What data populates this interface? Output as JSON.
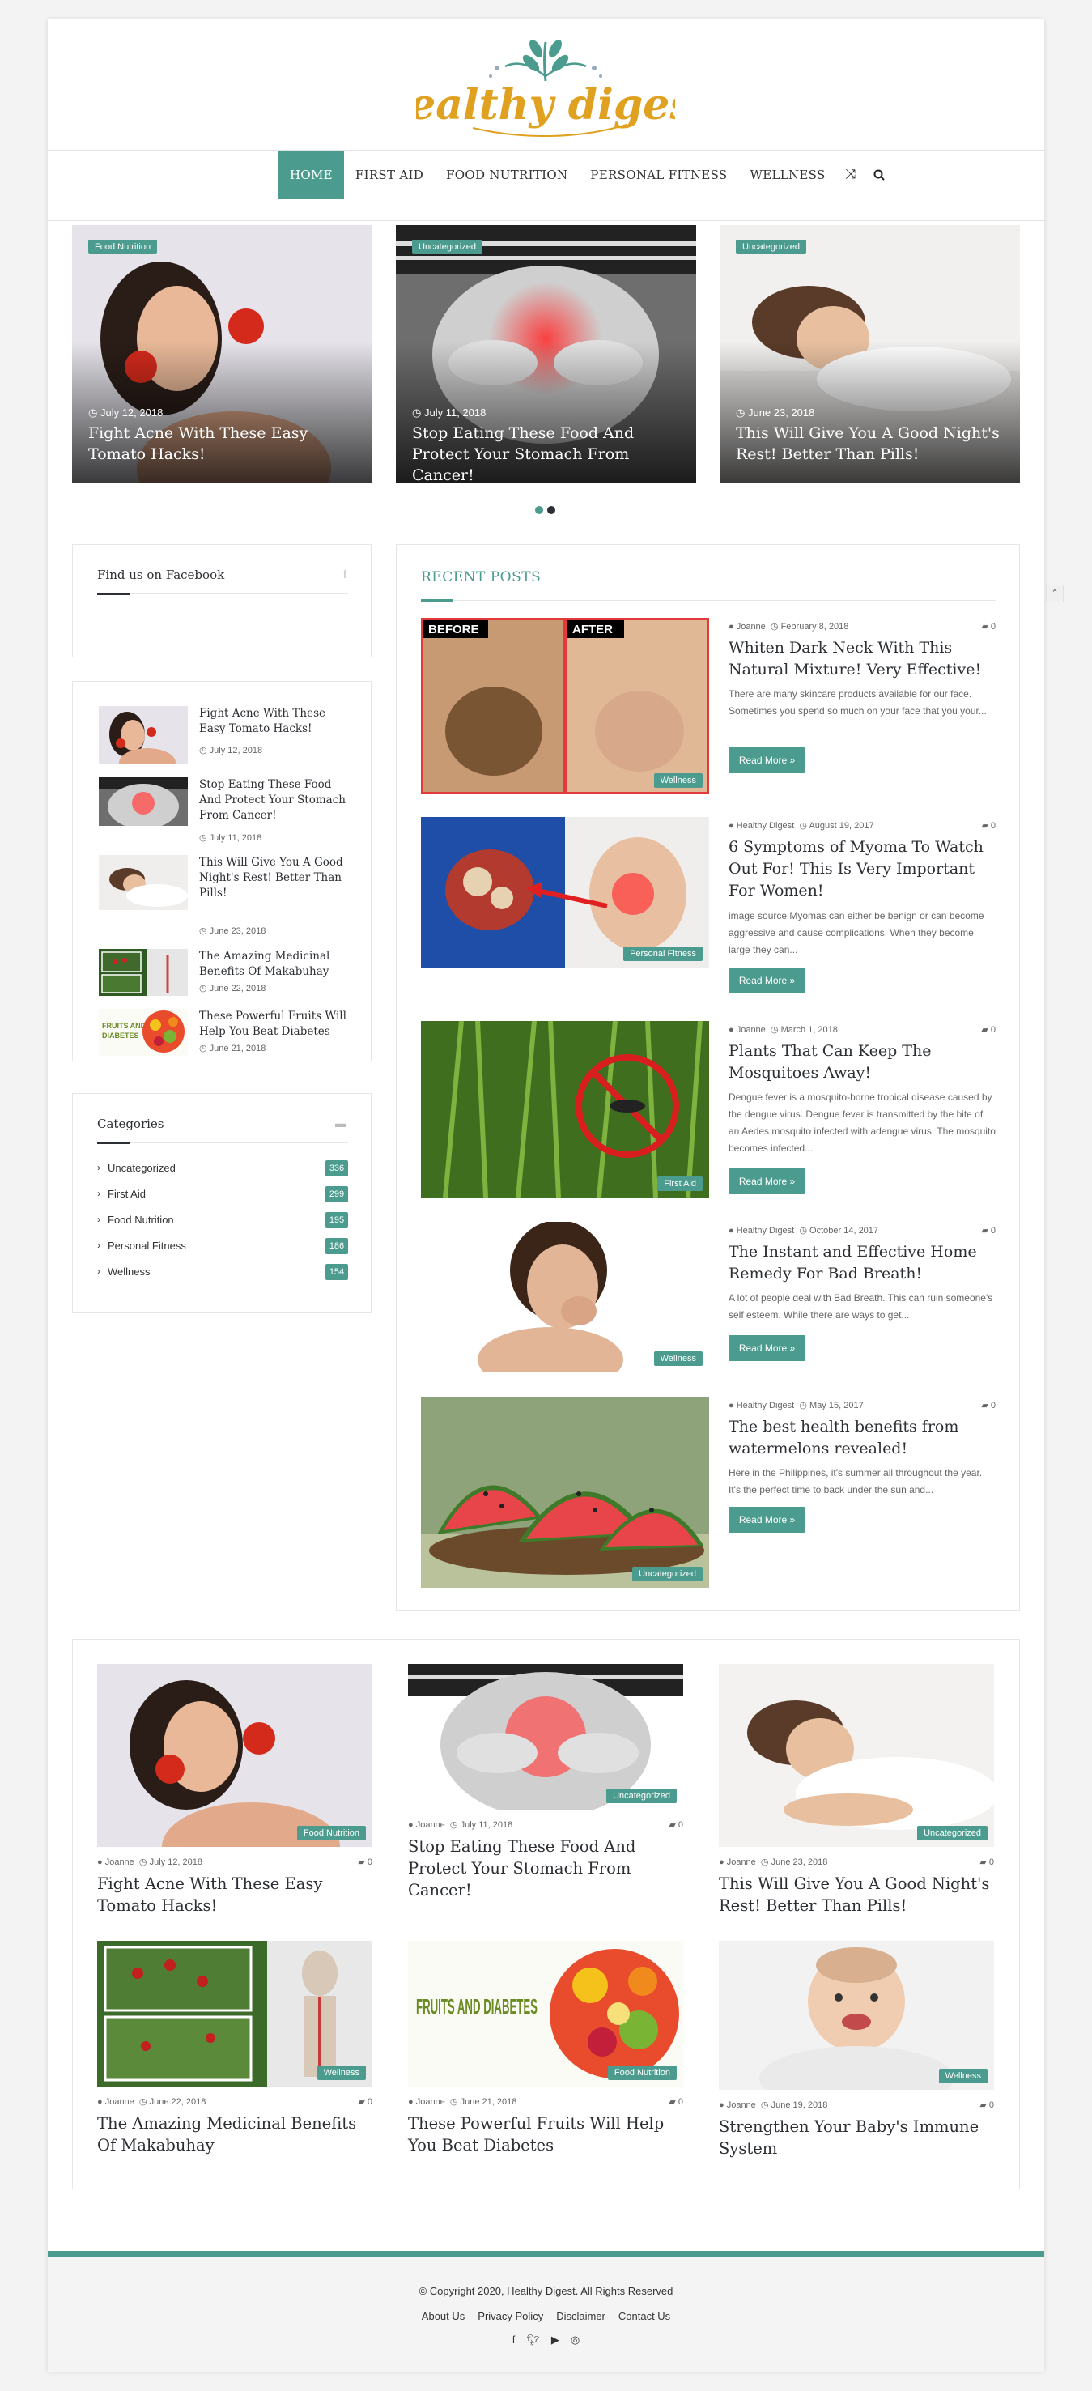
{
  "site": {
    "logo_text": "healthy digest",
    "nav": [
      "HOME",
      "FIRST AID",
      "FOOD NUTRITION",
      "PERSONAL FITNESS",
      "WELLNESS"
    ],
    "nav_icons": [
      "shuffle-icon",
      "search-icon"
    ]
  },
  "slider": [
    {
      "badge": "Food Nutrition",
      "date": "July 12, 2018",
      "title": "Fight Acne With These Easy Tomato Hacks!"
    },
    {
      "badge": "Uncategorized",
      "date": "July 11, 2018",
      "title": "Stop Eating These Food And Protect Your Stomach From Cancer!"
    },
    {
      "badge": "Uncategorized",
      "date": "June 23, 2018",
      "title": "This Will Give You A Good Night's Rest! Better Than Pills!"
    }
  ],
  "facebook": {
    "title": "Find us on Facebook",
    "icon": "facebook-icon"
  },
  "sidebar_posts": [
    {
      "title": "Fight Acne With These Easy Tomato Hacks!",
      "date": "July 12, 2018"
    },
    {
      "title": "Stop Eating These Food And Protect Your Stomach From Cancer!",
      "date": "July 11, 2018"
    },
    {
      "title": "This Will Give You A Good Night's Rest! Better Than Pills!",
      "date": "June 23, 2018"
    },
    {
      "title": "The Amazing Medicinal Benefits Of Makabuhay",
      "date": "June 22, 2018"
    },
    {
      "title": "These Powerful Fruits Will Help You Beat Diabetes",
      "date": "June 21, 2018"
    }
  ],
  "categories": {
    "title": "Categories",
    "items": [
      {
        "label": "Uncategorized",
        "count": "336"
      },
      {
        "label": "First Aid",
        "count": "299"
      },
      {
        "label": "Food Nutrition",
        "count": "195"
      },
      {
        "label": "Personal Fitness",
        "count": "186"
      },
      {
        "label": "Wellness",
        "count": "154"
      }
    ]
  },
  "recent": {
    "title": "RECENT POSTS",
    "read_more": "Read More »",
    "posts": [
      {
        "author": "Joanne",
        "date": "February 8, 2018",
        "comments": "0",
        "badge": "Wellness",
        "img_label_before": "BEFORE",
        "img_label_after": "AFTER",
        "title": "Whiten Dark Neck With This Natural Mixture! Very Effective!",
        "excerpt": "There are many skincare products available for our face. Sometimes you spend so much on your face that you your..."
      },
      {
        "author": "Healthy Digest",
        "date": "August 19, 2017",
        "comments": "0",
        "badge": "Personal Fitness",
        "title": "6 Symptoms of Myoma To Watch Out For! This Is Very Important For Women!",
        "excerpt": "image source Myomas can either be benign or can become aggressive and cause complications. When they become large they can..."
      },
      {
        "author": "Joanne",
        "date": "March 1, 2018",
        "comments": "0",
        "badge": "First Aid",
        "title": "Plants That Can Keep The Mosquitoes Away!",
        "excerpt": "Dengue fever is a mosquito-borne tropical disease caused by the dengue virus. Dengue fever is transmitted by the bite of an Aedes mosquito infected with adengue virus. The mosquito becomes infected..."
      },
      {
        "author": "Healthy Digest",
        "date": "October 14, 2017",
        "comments": "0",
        "badge": "Wellness",
        "title": "The Instant and Effective Home Remedy For Bad Breath!",
        "excerpt": "A lot of people deal with Bad Breath. This can ruin someone's self esteem. While there are ways to get..."
      },
      {
        "author": "Healthy Digest",
        "date": "May 15, 2017",
        "comments": "0",
        "badge": "Uncategorized",
        "title": "The best health benefits from watermelons revealed!",
        "excerpt": "Here in the Philippines, it's summer all throughout the year. It's the perfect time to back under the sun and..."
      }
    ]
  },
  "grid": [
    {
      "author": "Joanne",
      "date": "July 12, 2018",
      "comments": "0",
      "badge": "Food Nutrition",
      "title": "Fight Acne With These Easy Tomato Hacks!"
    },
    {
      "author": "Joanne",
      "date": "July 11, 2018",
      "comments": "0",
      "badge": "Uncategorized",
      "title": "Stop Eating These Food And Protect Your Stomach From Cancer!"
    },
    {
      "author": "Joanne",
      "date": "June 23, 2018",
      "comments": "0",
      "badge": "Uncategorized",
      "title": "This Will Give You A Good Night's Rest! Better Than Pills!"
    },
    {
      "author": "Joanne",
      "date": "June 22, 2018",
      "comments": "0",
      "badge": "Wellness",
      "title": "The Amazing Medicinal Benefits Of Makabuhay"
    },
    {
      "author": "Joanne",
      "date": "June 21, 2018",
      "comments": "0",
      "badge": "Food Nutrition",
      "img_text": "FRUITS AND DIABETES",
      "title": "These Powerful Fruits Will Help You Beat Diabetes"
    },
    {
      "author": "Joanne",
      "date": "June 19, 2018",
      "comments": "0",
      "badge": "Wellness",
      "title": "Strengthen Your Baby's Immune System"
    }
  ],
  "footer": {
    "copyright": "© Copyright 2020, Healthy Digest. All Rights Reserved",
    "links": [
      "About Us",
      "Privacy Policy",
      "Disclaimer",
      "Contact Us"
    ],
    "social_icons": [
      "facebook-icon",
      "twitter-icon",
      "youtube-icon",
      "instagram-icon"
    ]
  },
  "colors": {
    "accent": "#4b9b8e",
    "logo": "#e0a020",
    "text": "#2c2f34"
  }
}
